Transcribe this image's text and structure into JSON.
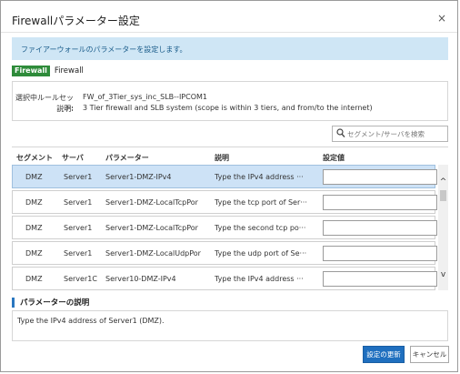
{
  "dialog": {
    "title": "Firewallパラメーター設定",
    "close_glyph": "×"
  },
  "info_banner": "ファイアーウォールのパラメーターを設定します。",
  "firewall": {
    "badge": "Firewall",
    "name": "Firewall"
  },
  "ruleset": {
    "selected_label": "選択中ルールセット:",
    "selected_value": "FW_of_3Tier_sys_inc_SLB--IPCOM1",
    "desc_label": "説明:",
    "desc_value": "3 Tier firewall and SLB system (scope is within 3 tiers, and from/to the internet)"
  },
  "search": {
    "placeholder": "セグメント/サーバを検索",
    "icon": "search-icon"
  },
  "table": {
    "headers": {
      "segment": "セグメント",
      "server": "サーバ",
      "parameter": "パラメーター",
      "description": "説明",
      "value": "設定値"
    },
    "rows": [
      {
        "segment": "DMZ",
        "server": "Server1",
        "parameter": "Server1-DMZ-IPv4",
        "description": "Type the IPv4 address ···",
        "value": ""
      },
      {
        "segment": "DMZ",
        "server": "Server1",
        "parameter": "Server1-DMZ-LocalTcpPor",
        "description": "Type the tcp port of Ser···",
        "value": ""
      },
      {
        "segment": "DMZ",
        "server": "Server1",
        "parameter": "Server1-DMZ-LocalTcpPor",
        "description": "Type the second tcp po···",
        "value": ""
      },
      {
        "segment": "DMZ",
        "server": "Server1",
        "parameter": "Server1-DMZ-LocalUdpPor",
        "description": "Type the udp port of Se···",
        "value": ""
      },
      {
        "segment": "DMZ",
        "server": "Server1C",
        "parameter": "Server10-DMZ-IPv4",
        "description": "Type the IPv4 address ···",
        "value": ""
      }
    ],
    "selected_row": 0,
    "scroll": {
      "up_glyph": "^",
      "down_glyph": "v"
    }
  },
  "param_description": {
    "title": "パラメーターの説明",
    "text": "Type the IPv4 address of Server1 (DMZ)."
  },
  "buttons": {
    "update": "設定の更新",
    "cancel": "キャンセル"
  },
  "colors": {
    "accent": "#1f6fbf",
    "info_bg": "#cfe6f5",
    "badge": "#2e8b3a",
    "selected_row": "#cde2f6"
  }
}
